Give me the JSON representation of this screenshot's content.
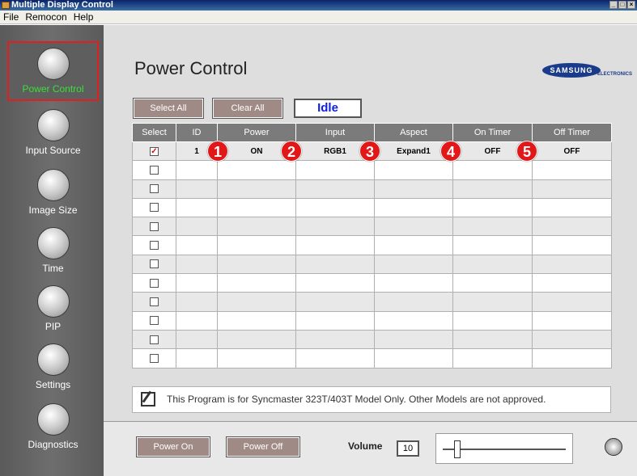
{
  "window": {
    "title": "Multiple Display Control",
    "controls": [
      "_",
      "□",
      "×"
    ]
  },
  "menu": [
    "File",
    "Remocon",
    "Help"
  ],
  "sidebar": {
    "items": [
      {
        "label": "Power Control",
        "icon": "power-control-icon",
        "active": true
      },
      {
        "label": "Input Source",
        "icon": "input-source-icon"
      },
      {
        "label": "Image Size",
        "icon": "image-size-icon"
      },
      {
        "label": "Time",
        "icon": "time-icon"
      },
      {
        "label": "PIP",
        "icon": "pip-icon"
      },
      {
        "label": "Settings",
        "icon": "settings-icon"
      },
      {
        "label": "Diagnostics",
        "icon": "diagnostics-icon"
      }
    ]
  },
  "main": {
    "title": "Power Control",
    "logo": {
      "brand": "SAMSUNG",
      "sub": "ELECTRONICS"
    },
    "toolbar": {
      "select_all": "Select All",
      "clear_all": "Clear All",
      "status": "Idle"
    },
    "table": {
      "headers": [
        "Select",
        "ID",
        "Power",
        "Input",
        "Aspect",
        "On Timer",
        "Off Timer"
      ],
      "rows": [
        {
          "checked": "✓",
          "id": "1",
          "power": "ON",
          "input": "RGB1",
          "aspect": "Expand1",
          "on_timer": "OFF",
          "off_timer": "OFF"
        },
        {
          "checked": "",
          "id": "",
          "power": "",
          "input": "",
          "aspect": "",
          "on_timer": "",
          "off_timer": ""
        },
        {
          "checked": "",
          "id": "",
          "power": "",
          "input": "",
          "aspect": "",
          "on_timer": "",
          "off_timer": ""
        },
        {
          "checked": "",
          "id": "",
          "power": "",
          "input": "",
          "aspect": "",
          "on_timer": "",
          "off_timer": ""
        },
        {
          "checked": "",
          "id": "",
          "power": "",
          "input": "",
          "aspect": "",
          "on_timer": "",
          "off_timer": ""
        },
        {
          "checked": "",
          "id": "",
          "power": "",
          "input": "",
          "aspect": "",
          "on_timer": "",
          "off_timer": ""
        },
        {
          "checked": "",
          "id": "",
          "power": "",
          "input": "",
          "aspect": "",
          "on_timer": "",
          "off_timer": ""
        },
        {
          "checked": "",
          "id": "",
          "power": "",
          "input": "",
          "aspect": "",
          "on_timer": "",
          "off_timer": ""
        },
        {
          "checked": "",
          "id": "",
          "power": "",
          "input": "",
          "aspect": "",
          "on_timer": "",
          "off_timer": ""
        },
        {
          "checked": "",
          "id": "",
          "power": "",
          "input": "",
          "aspect": "",
          "on_timer": "",
          "off_timer": ""
        },
        {
          "checked": "",
          "id": "",
          "power": "",
          "input": "",
          "aspect": "",
          "on_timer": "",
          "off_timer": ""
        },
        {
          "checked": "",
          "id": "",
          "power": "",
          "input": "",
          "aspect": "",
          "on_timer": "",
          "off_timer": ""
        }
      ]
    },
    "markers": [
      "1",
      "2",
      "3",
      "4",
      "5"
    ],
    "notice": "This Program is for Syncmaster 323T/403T Model Only. Other Models are not approved."
  },
  "bottom": {
    "power_on": "Power On",
    "power_off": "Power Off",
    "volume_label": "Volume",
    "volume_value": "10",
    "volume_level": 10
  },
  "colors": {
    "sidebar_bg": "#666666",
    "active_label": "#38e038",
    "active_border": "#e02020",
    "header_bg": "#7b7b7b",
    "marker": "#e21818",
    "status_text": "#1020e0"
  }
}
